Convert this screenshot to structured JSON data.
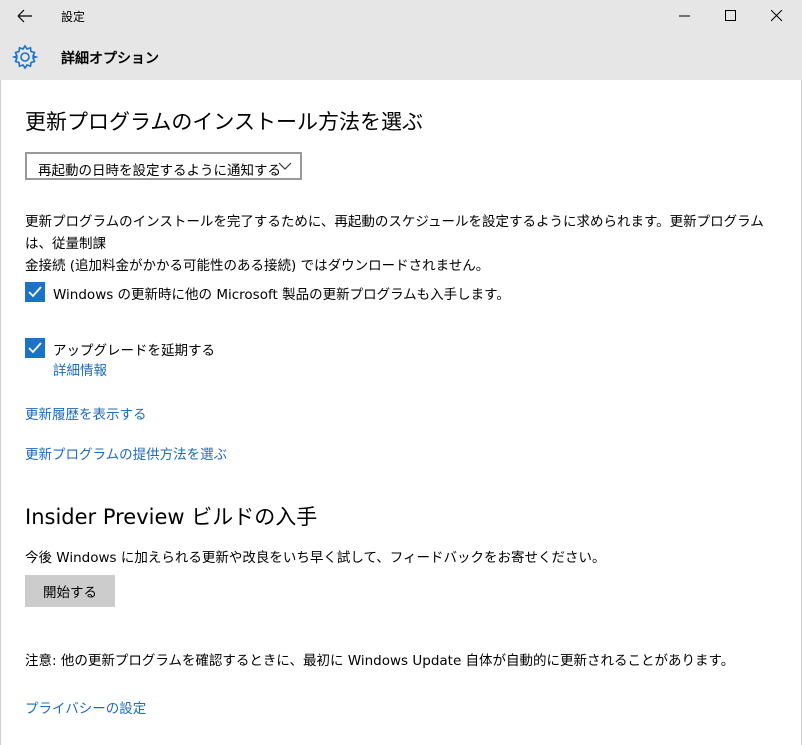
{
  "window": {
    "title": "設定",
    "header_title": "詳細オプション"
  },
  "install": {
    "heading": "更新プログラムのインストール方法を選ぶ",
    "selected_option": "再起動の日時を設定するように通知する",
    "description_line1": "更新プログラムのインストールを完了するために、再起動のスケジュールを設定するように求められます。更新プログラムは、従量制課",
    "description_line2": "金接続 (追加料金がかかる可能性のある接続) ではダウンロードされません。"
  },
  "options": {
    "microsoft_updates_label": "Windows の更新時に他の Microsoft 製品の更新プログラムも入手します。",
    "microsoft_updates_checked": true,
    "defer_upgrades_label": "アップグレードを延期する",
    "defer_upgrades_checked": true,
    "more_info_link": "詳細情報"
  },
  "links": {
    "update_history": "更新履歴を表示する",
    "delivery_method": "更新プログラムの提供方法を選ぶ"
  },
  "insider": {
    "heading": "Insider Preview ビルドの入手",
    "description": "今後 Windows に加えられる更新や改良をいち早く試して、フィードバックをお寄せください。",
    "start_button": "開始する"
  },
  "note": "注意: 他の更新プログラムを確認するときに、最初に Windows Update 自体が自動的に更新されることがあります。",
  "privacy_link": "プライバシーの設定",
  "colors": {
    "accent": "#1c73c6",
    "link": "#1b6bbf",
    "header_bg": "#e6e6e6"
  }
}
